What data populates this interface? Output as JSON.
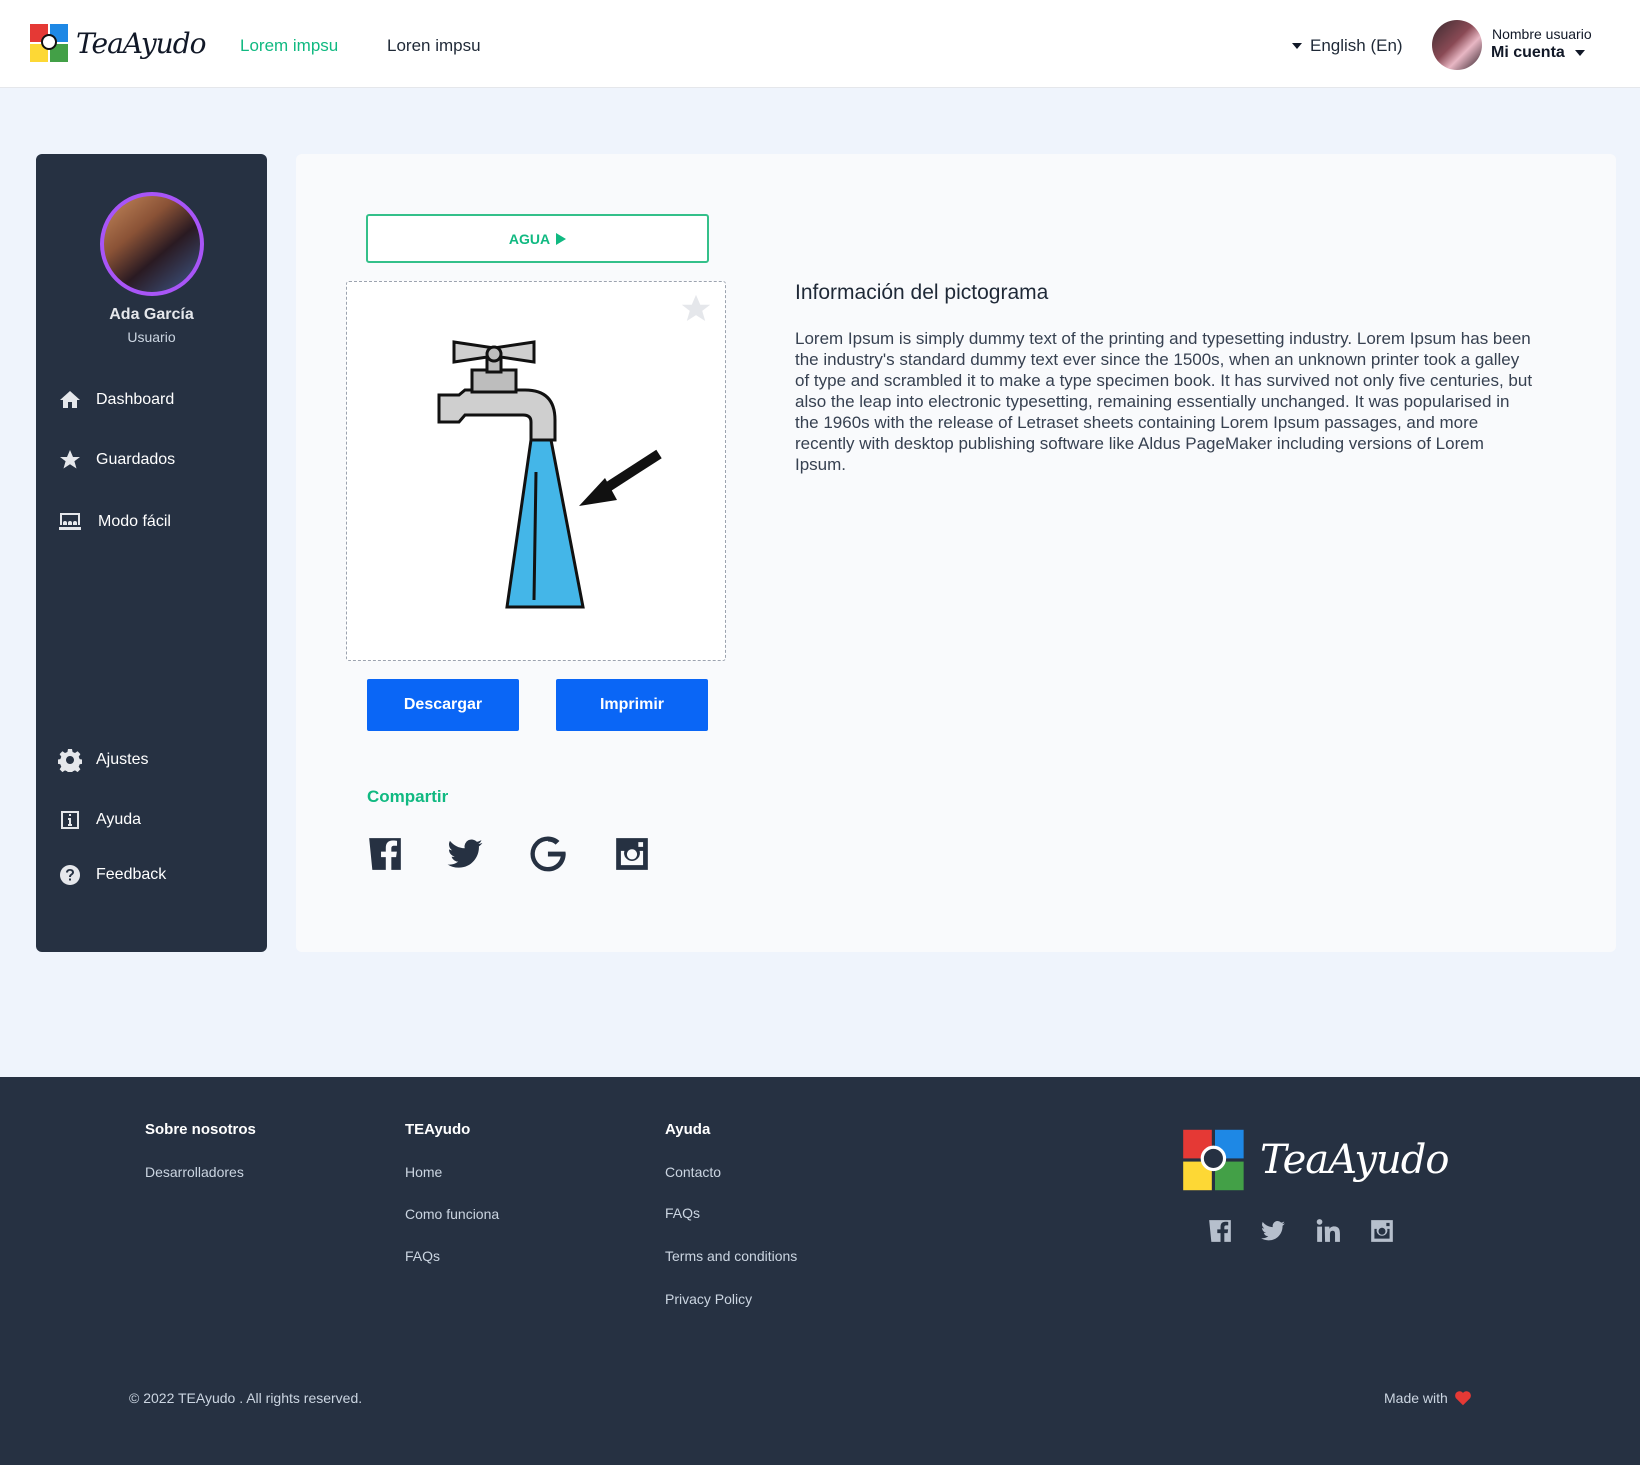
{
  "header": {
    "brand": "TeaAyudo",
    "nav": [
      "Lorem impsu",
      "Loren impsu"
    ],
    "language": "English (En)",
    "user_label": "Nombre usuario",
    "account_label": "Mi cuenta"
  },
  "sidebar": {
    "name": "Ada García",
    "role": "Usuario",
    "items": [
      {
        "label": "Dashboard",
        "icon": "home-icon"
      },
      {
        "label": "Guardados",
        "icon": "star-icon"
      },
      {
        "label": "Modo fácil",
        "icon": "easy-mode-icon"
      },
      {
        "label": "Ajustes",
        "icon": "gear-icon"
      },
      {
        "label": "Ayuda",
        "icon": "info-icon"
      },
      {
        "label": "Feedback",
        "icon": "question-icon"
      }
    ]
  },
  "main": {
    "pictogram_title": "AGUA",
    "download_label": "Descargar",
    "print_label": "Imprimir",
    "share_label": "Compartir",
    "share_icons": [
      "facebook-icon",
      "twitter-icon",
      "google-icon",
      "instagram-icon"
    ],
    "info_title": "Información del pictograma",
    "info_text": "Lorem Ipsum is simply dummy text of the printing and typesetting industry. Lorem Ipsum has been the industry's standard dummy text ever since the 1500s, when an unknown printer took a galley of type and scrambled it to make a type specimen book. It has survived not only five centuries, but also the leap into electronic typesetting, remaining essentially unchanged. It was popularised in the 1960s with the release of Letraset sheets containing Lorem Ipsum passages, and more recently with desktop publishing software like Aldus PageMaker including versions of Lorem Ipsum."
  },
  "footer": {
    "col1": {
      "title": "Sobre nosotros",
      "links": [
        "Desarrolladores"
      ]
    },
    "col2": {
      "title": "TEAyudo",
      "links": [
        "Home",
        "Como funciona",
        "FAQs"
      ]
    },
    "col3": {
      "title": "Ayuda",
      "links": [
        "Contacto",
        "FAQs",
        "Terms and conditions",
        "Privacy Policy"
      ]
    },
    "brand": "TeaAyudo",
    "social": [
      "facebook-icon",
      "twitter-icon",
      "linkedin-icon",
      "instagram-icon"
    ],
    "copyright": "© 2022 TEAyudo  . All rights reserved.",
    "made_with": "Made with"
  },
  "colors": {
    "accent": "#10b981",
    "primary_button": "#0a66f6",
    "dark_panel": "#263142",
    "page_bg": "#eff4fc",
    "avatar_ring": "#a855f7"
  }
}
